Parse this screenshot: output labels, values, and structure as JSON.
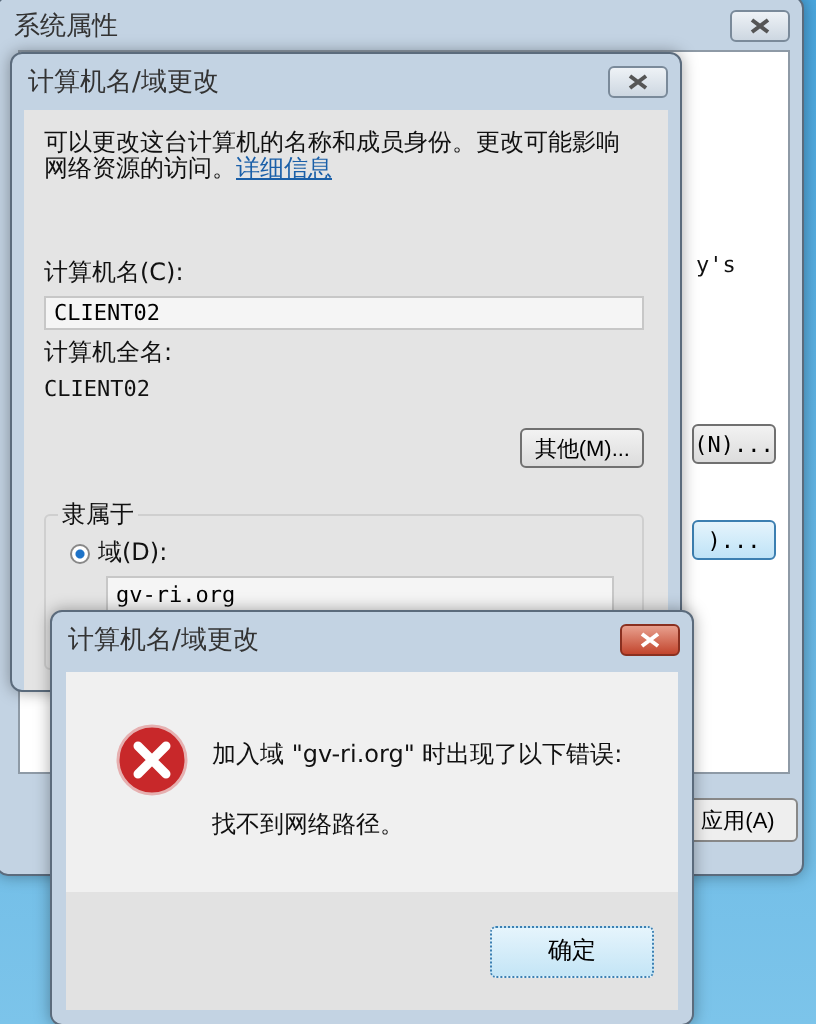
{
  "back_window": {
    "title": "系统属性",
    "partial_text": "y's",
    "buttons": [
      {
        "label": "(N)...",
        "focused": false
      },
      {
        "label": ")...",
        "focused": true
      }
    ],
    "apply_button": "应用(A)"
  },
  "name_dialog": {
    "title": "计算机名/域更改",
    "intro": "可以更改这台计算机的名称和成员身份。更改可能影响网络资源的访问。",
    "link": "详细信息",
    "computer_name_label": "计算机名(C):",
    "computer_name": "CLIENT02",
    "full_name_label": "计算机全名:",
    "full_name": "CLIENT02",
    "more_button": "其他(M)...",
    "member_of": "隶属于",
    "options": [
      {
        "label": "域(D):",
        "selected": true,
        "value": "gv-ri.org"
      }
    ]
  },
  "error_dialog": {
    "title": "计算机名/域更改",
    "message": "加入域 \"gv-ri.org\" 时出现了以下错误:",
    "detail": "找不到网络路径。",
    "ok_button": "确定"
  }
}
